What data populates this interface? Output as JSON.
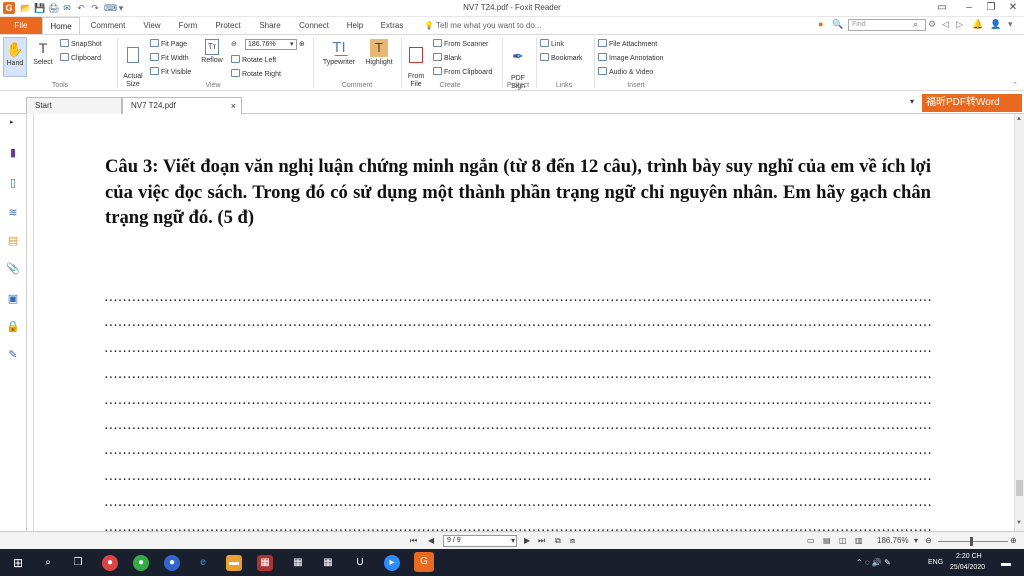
{
  "window": {
    "title": "NV7 T24.pdf - Foxit Reader",
    "app_icon": "G",
    "qa_glyphs": [
      "📂",
      "💾",
      "🖨",
      "✉",
      "↶",
      "↷",
      "⌨",
      "▾"
    ],
    "controls": [
      "▭",
      "–",
      "❐",
      "✕"
    ]
  },
  "menu": {
    "file": "File",
    "tabs": [
      "Home",
      "Comment",
      "View",
      "Form",
      "Protect",
      "Share",
      "Connect",
      "Help",
      "Extras"
    ],
    "tell_me": "Tell me what you want to do...",
    "find_placeholder": "Find"
  },
  "ribbon": {
    "hand": "Hand",
    "select": "Select",
    "snapshot": "SnapShot",
    "clipboard": "Clipboard",
    "tools_group": "Tools",
    "actual_size": "Actual\nSize",
    "fit_page": "Fit Page",
    "fit_width": "Fit Width",
    "fit_visible": "Fit Visible",
    "reflow": "Reflow",
    "zoom_value": "186.76%",
    "rotate_left": "Rotate Left",
    "rotate_right": "Rotate Right",
    "view_group": "View",
    "typewriter": "Typewriter",
    "highlight": "Highlight",
    "comment_group": "Comment",
    "from_file": "From\nFile",
    "from_scanner": "From Scanner",
    "blank": "Blank",
    "from_clipboard": "From Clipboard",
    "create_group": "Create",
    "pdf_sign": "PDF\nSign",
    "protect_group": "Protect",
    "link": "Link",
    "bookmark": "Bookmark",
    "links_group": "Links",
    "file_attachment": "File Attachment",
    "image_annotation": "Image Annotation",
    "audio_video": "Audio & Video",
    "insert_group": "Insert"
  },
  "doc_tabs": {
    "start": "Start",
    "current": "NV7 T24.pdf",
    "close": "×",
    "promo": "福昕PDF转Word"
  },
  "document": {
    "question": "Câu 3: Viết đoạn văn nghị luận chứng minh ngắn (từ 8 đến 12 câu), trình bày suy nghĩ của em về ích lợi của việc đọc sách. Trong đó có sử dụng một thành phần trạng ngữ chỉ nguyên nhân. Em hãy gạch chân trạng ngữ đó. (5 đ)",
    "dots": "......................................................................................................................................................................................................................................................."
  },
  "status": {
    "page": "9 / 9",
    "zoom": "186.76%"
  },
  "taskbar": {
    "time": "2:20 CH",
    "date": "25/04/2020",
    "lang": "ENG"
  },
  "colors": {
    "accent": "#e8691f",
    "taskbar": "#1a1f2e"
  }
}
